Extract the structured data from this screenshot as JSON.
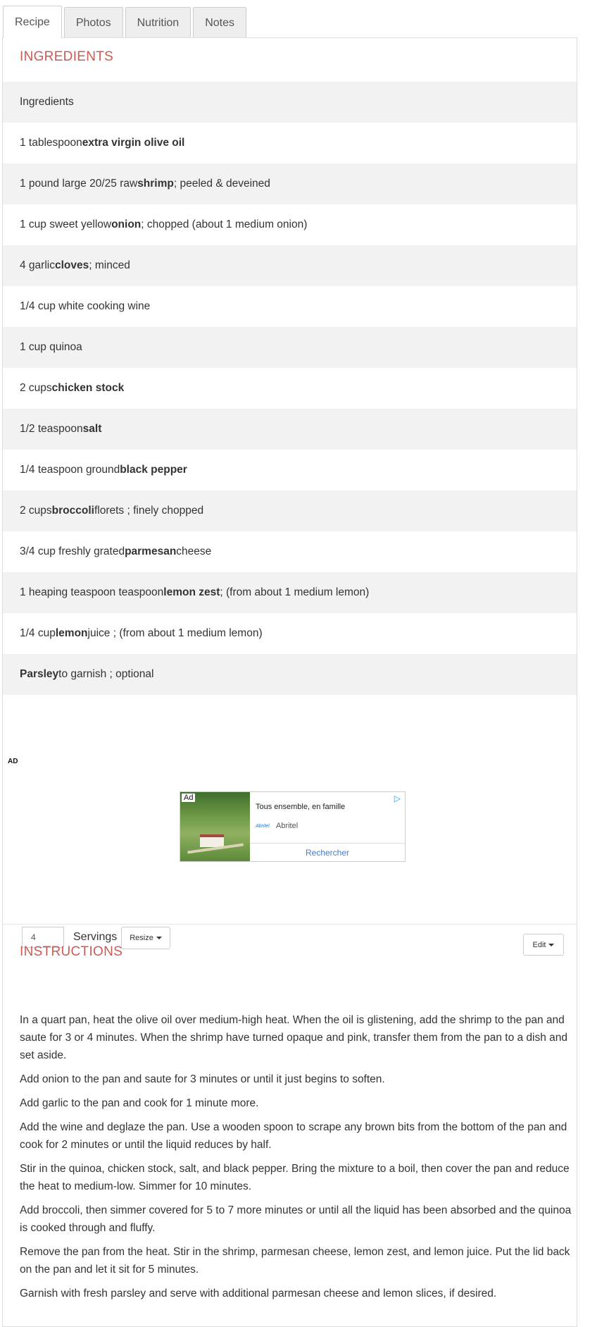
{
  "tabs": [
    "Recipe",
    "Photos",
    "Nutrition",
    "Notes"
  ],
  "active_tab": "Recipe",
  "ingredients_title": "INGREDIENTS",
  "ingredients": [
    {
      "pre": "Ingredients",
      "bold": "",
      "post": ""
    },
    {
      "pre": "1 tablespoon ",
      "bold": "extra virgin olive oil",
      "post": ""
    },
    {
      "pre": "1 pound large 20/25 raw ",
      "bold": "shrimp",
      "post": " ; peeled & deveined"
    },
    {
      "pre": "1 cup sweet yellow ",
      "bold": "onion",
      "post": " ; chopped (about 1 medium onion)"
    },
    {
      "pre": "4 garlic ",
      "bold": "cloves",
      "post": " ; minced"
    },
    {
      "pre": "1/4 cup white cooking wine",
      "bold": "",
      "post": ""
    },
    {
      "pre": "1 cup quinoa",
      "bold": "",
      "post": ""
    },
    {
      "pre": "2 cups ",
      "bold": "chicken stock",
      "post": ""
    },
    {
      "pre": "1/2 teaspoon ",
      "bold": "salt",
      "post": ""
    },
    {
      "pre": "1/4 teaspoon ground ",
      "bold": "black pepper",
      "post": ""
    },
    {
      "pre": "2 cups ",
      "bold": "broccoli",
      "post": " florets ; finely chopped"
    },
    {
      "pre": "3/4 cup freshly grated ",
      "bold": "parmesan",
      "post": " cheese"
    },
    {
      "pre": "1 heaping teaspoon teaspoon ",
      "bold": "lemon zest",
      "post": " ; (from about 1 medium lemon)"
    },
    {
      "pre": "1/4 cup ",
      "bold": "lemon",
      "post": " juice ; (from about 1 medium lemon)"
    },
    {
      "pre": "",
      "bold": "Parsley",
      "post": " to garnish ; optional"
    }
  ],
  "ad": {
    "label": "AD",
    "badge": "Ad",
    "headline": "Tous ensemble, en famille",
    "brand_logo": "Abritel",
    "brand": "Abritel",
    "cta": "Rechercher"
  },
  "servings": {
    "value": "4",
    "label": "Servings",
    "resize_label": "Resize"
  },
  "edit_label": "Edit",
  "instructions_title": "INSTRUCTIONS",
  "instructions": [
    "In a quart pan, heat the olive oil over medium-high heat. When the oil is glistening, add the shrimp to the pan and saute for 3 or 4 minutes. When the shrimp have turned opaque and pink, transfer them from the pan to a dish and set aside.",
    "Add onion to the pan and saute for 3 minutes or until it just begins to soften.",
    "Add garlic to the pan and cook for 1 minute more.",
    "Add the wine and deglaze the pan. Use a wooden spoon to scrape any brown bits from the bottom of the pan and cook for 2 minutes or until the liquid reduces by half.",
    "Stir in the quinoa, chicken stock, salt, and black pepper. Bring the mixture to a boil, then cover the pan and reduce the heat to medium-low. Simmer for 10 minutes.",
    "Add broccoli, then simmer covered for 5 to 7 more minutes or until all the liquid has been absorbed and the quinoa is cooked through and fluffy.",
    "Remove the pan from the heat. Stir in the shrimp, parmesan cheese, lemon zest, and lemon juice. Put the lid back on the pan and let it sit for 5 minutes.",
    "Garnish with fresh parsley and serve with additional parmesan cheese and lemon slices, if desired."
  ],
  "colors": {
    "accent": "#cc5a55",
    "stripe": "#f2f2f2",
    "link": "#4a78c6"
  }
}
